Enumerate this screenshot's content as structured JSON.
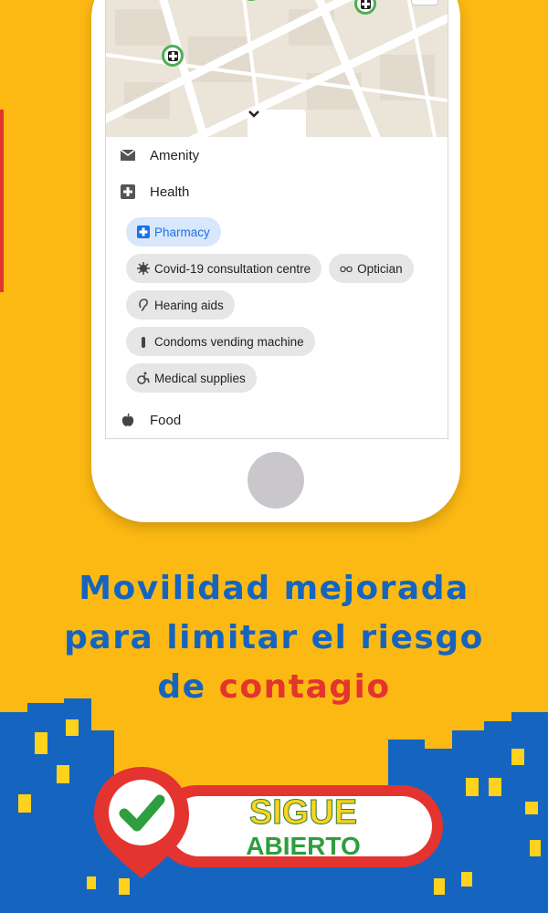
{
  "map": {
    "toggle_icon": "chevron-down-icon"
  },
  "categories": [
    {
      "label": "Amenity",
      "icon": "envelope-icon"
    },
    {
      "label": "Health",
      "icon": "plus-square-icon"
    },
    {
      "label": "Food",
      "icon": "apple-icon"
    }
  ],
  "health_chips": [
    {
      "label": "Pharmacy",
      "icon": "pharmacy-icon",
      "selected": true
    },
    {
      "label": "Covid-19 consultation centre",
      "icon": "virus-icon",
      "selected": false
    },
    {
      "label": "Optician",
      "icon": "glasses-icon",
      "selected": false
    },
    {
      "label": "Hearing aids",
      "icon": "ear-icon",
      "selected": false
    },
    {
      "label": "Condoms vending machine",
      "icon": "condom-icon",
      "selected": false
    },
    {
      "label": "Medical supplies",
      "icon": "wheelchair-icon",
      "selected": false
    }
  ],
  "headline": {
    "line1": "Movilidad mejorada",
    "line2": "para limitar el riesgo",
    "line3_prefix": "de ",
    "line3_highlight": "contagio"
  },
  "badge": {
    "line1": "SIGUE",
    "line2": "ABIERTO"
  },
  "colors": {
    "background": "#FDB913",
    "headline_blue": "#1565C0",
    "highlight_red": "#E3342F",
    "city_blue": "#1565C0",
    "check_green": "#2E9E3E",
    "chip_active_bg": "#d8e7fb",
    "chip_active_text": "#1a73e8"
  }
}
